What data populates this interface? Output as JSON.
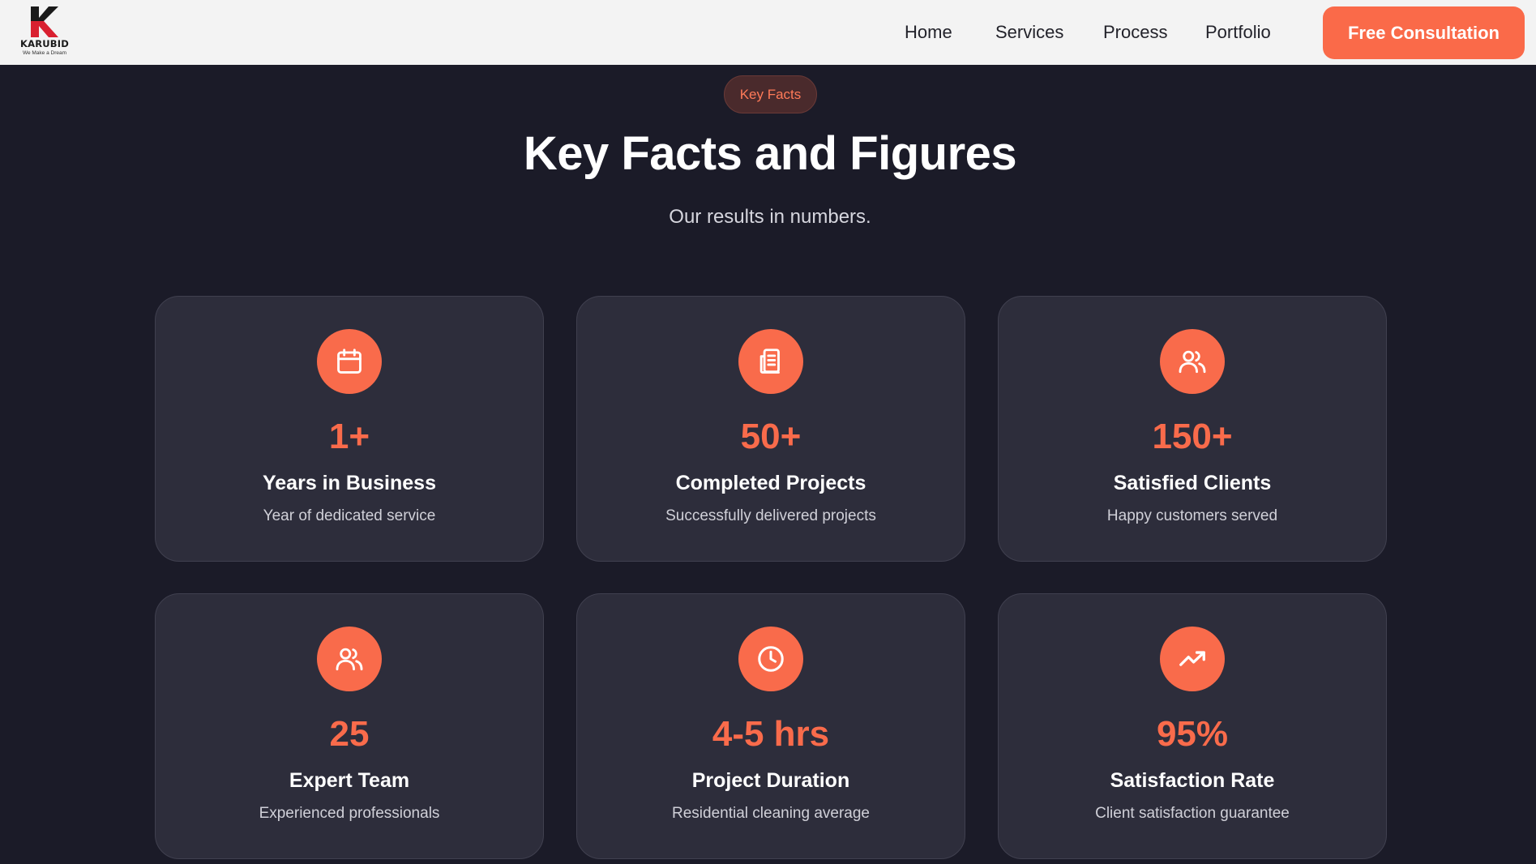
{
  "brand": {
    "name": "KARUBID",
    "tagline": "We Make a Dream"
  },
  "nav": {
    "links": [
      "Home",
      "Services",
      "Process",
      "Portfolio"
    ],
    "cta": "Free Consultation"
  },
  "section": {
    "badge": "Key Facts",
    "title": "Key Facts and Figures",
    "subtitle": "Our results in numbers."
  },
  "colors": {
    "accent": "#f96b4b",
    "background": "#1b1b28",
    "card": "#2d2d3b"
  },
  "stats": [
    {
      "icon": "calendar-icon",
      "value": "1+",
      "label": "Years in Business",
      "desc": "Year of dedicated service"
    },
    {
      "icon": "document-icon",
      "value": "50+",
      "label": "Completed Projects",
      "desc": "Successfully delivered projects"
    },
    {
      "icon": "users-icon",
      "value": "150+",
      "label": "Satisfied Clients",
      "desc": "Happy customers served"
    },
    {
      "icon": "team-icon",
      "value": "25",
      "label": "Expert Team",
      "desc": "Experienced professionals"
    },
    {
      "icon": "clock-icon",
      "value": "4-5 hrs",
      "label": "Project Duration",
      "desc": "Residential cleaning average"
    },
    {
      "icon": "trending-up-icon",
      "value": "95%",
      "label": "Satisfaction Rate",
      "desc": "Client satisfaction guarantee"
    }
  ]
}
